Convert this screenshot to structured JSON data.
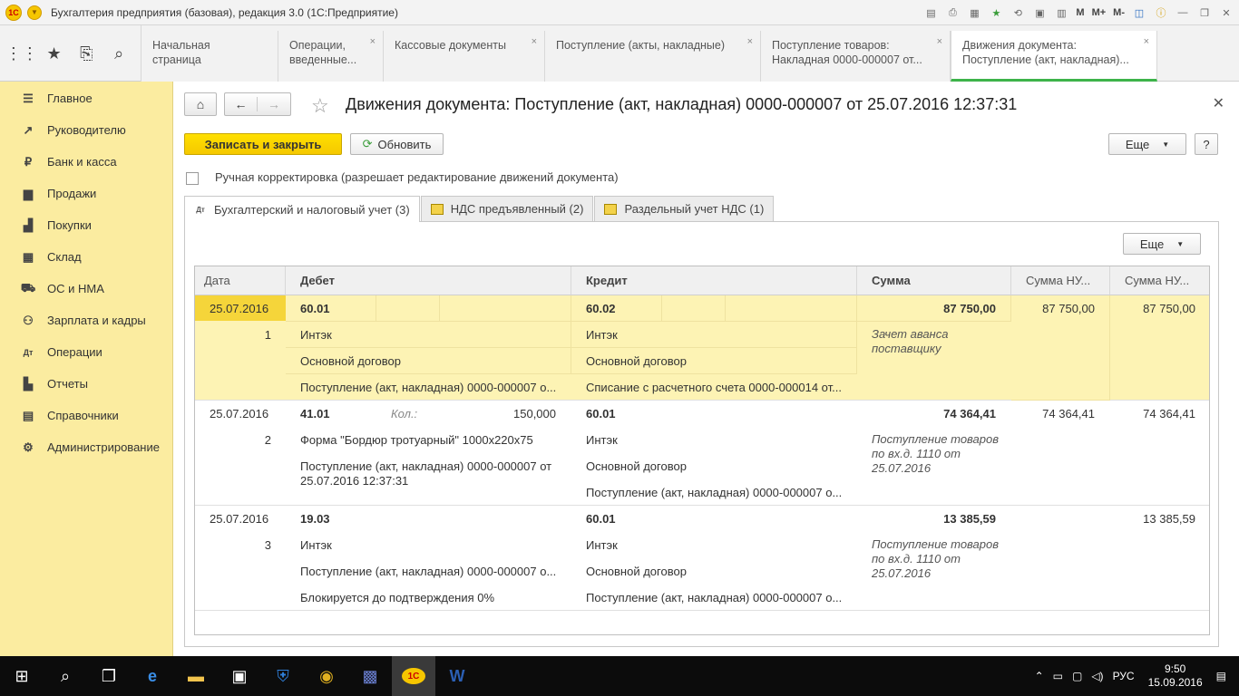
{
  "window": {
    "title": "Бухгалтерия предприятия (базовая), редакция 3.0  (1С:Предприятие)",
    "m_labels": [
      "M",
      "M+",
      "M-"
    ]
  },
  "open_tabs": [
    {
      "label": "Начальная страница",
      "closable": false
    },
    {
      "label": "Операции, введенные...",
      "closable": true
    },
    {
      "label": "Кассовые документы",
      "closable": true
    },
    {
      "label": "Поступление (акты, накладные)",
      "closable": true
    },
    {
      "label": "Поступление товаров: Накладная 0000-000007 от...",
      "closable": true
    },
    {
      "label": "Движения документа: Поступление (акт, накладная)...",
      "closable": true
    }
  ],
  "sidebar": {
    "items": [
      {
        "label": "Главное",
        "icon": "menu-icon"
      },
      {
        "label": "Руководителю",
        "icon": "chart-icon"
      },
      {
        "label": "Банк и касса",
        "icon": "ruble-icon"
      },
      {
        "label": "Продажи",
        "icon": "bag-icon"
      },
      {
        "label": "Покупки",
        "icon": "cart-icon"
      },
      {
        "label": "Склад",
        "icon": "warehouse-icon"
      },
      {
        "label": "ОС и НМА",
        "icon": "truck-icon"
      },
      {
        "label": "Зарплата и кадры",
        "icon": "people-icon"
      },
      {
        "label": "Операции",
        "icon": "dtkt-icon"
      },
      {
        "label": "Отчеты",
        "icon": "report-icon"
      },
      {
        "label": "Справочники",
        "icon": "book-icon"
      },
      {
        "label": "Администрирование",
        "icon": "gear-icon"
      }
    ]
  },
  "document": {
    "title": "Движения документа: Поступление (акт, накладная) 0000-000007 от 25.07.2016 12:37:31",
    "save_close_label": "Записать и закрыть",
    "refresh_label": "Обновить",
    "more_label": "Еще",
    "help_label": "?",
    "manual_label": "Ручная корректировка (разрешает редактирование движений документа)",
    "manual_checked": false
  },
  "page_tabs": [
    {
      "label": "Бухгалтерский и налоговый учет (3)",
      "icon": "dtkt-icon",
      "active": true
    },
    {
      "label": "НДС предъявленный (2)",
      "icon": "register-icon",
      "active": false
    },
    {
      "label": "Раздельный учет НДС (1)",
      "icon": "register-icon",
      "active": false
    }
  ],
  "table": {
    "more_label": "Еще",
    "headers": [
      "Дата",
      "Дебет",
      "Кредит",
      "Сумма",
      "Сумма НУ...",
      "Сумма НУ..."
    ],
    "rows": [
      {
        "date": "25.07.2016",
        "num": "1",
        "debit_account": "60.01",
        "debit_qty_label": "",
        "debit_qty": "",
        "debit_lines": [
          "Интэк",
          "Основной договор",
          "Поступление (акт, накладная) 0000-000007 о..."
        ],
        "credit_account": "60.02",
        "credit_lines": [
          "Интэк",
          "Основной договор",
          "Списание с расчетного счета 0000-000014 от..."
        ],
        "sum": "87 750,00",
        "sum_comment": "Зачет аванса поставщику",
        "sum_nu1": "87 750,00",
        "sum_nu2": "87 750,00"
      },
      {
        "date": "25.07.2016",
        "num": "2",
        "debit_account": "41.01",
        "debit_qty_label": "Кол.:",
        "debit_qty": "150,000",
        "debit_lines": [
          "Форма \"Бордюр тротуарный\" 1000х220х75",
          "Поступление (акт, накладная) 0000-000007 от 25.07.2016 12:37:31"
        ],
        "credit_account": "60.01",
        "credit_lines": [
          "Интэк",
          "Основной договор",
          "Поступление (акт, накладная) 0000-000007 о..."
        ],
        "sum": "74 364,41",
        "sum_comment": "Поступление товаров по вх.д. 1110 от 25.07.2016",
        "sum_nu1": "74 364,41",
        "sum_nu2": "74 364,41"
      },
      {
        "date": "25.07.2016",
        "num": "3",
        "debit_account": "19.03",
        "debit_qty_label": "",
        "debit_qty": "",
        "debit_lines": [
          "Интэк",
          "Поступление (акт, накладная) 0000-000007 о...",
          "Блокируется до подтверждения 0%"
        ],
        "credit_account": "60.01",
        "credit_lines": [
          "Интэк",
          "Основной договор",
          "Поступление (акт, накладная) 0000-000007 о..."
        ],
        "sum": "13 385,59",
        "sum_comment": "Поступление товаров по вх.д. 1110 от 25.07.2016",
        "sum_nu1": "",
        "sum_nu2": "13 385,59"
      }
    ]
  },
  "taskbar": {
    "lang": "РУС",
    "time": "9:50",
    "date": "15.09.2016"
  }
}
